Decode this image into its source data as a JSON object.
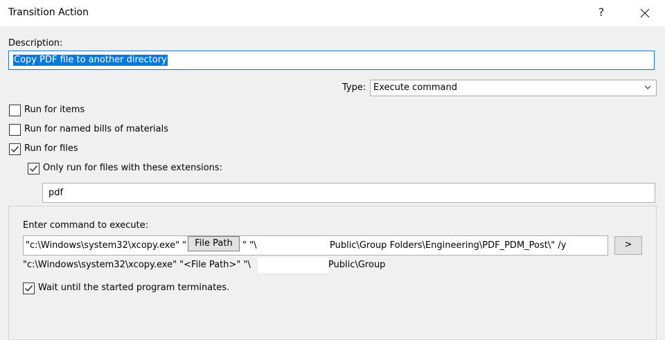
{
  "window": {
    "title": "Transition Action",
    "help_label": "?"
  },
  "description": {
    "label": "Description:",
    "value": "Copy PDF file to another directory"
  },
  "type": {
    "label": "Type:",
    "selected": "Execute command"
  },
  "checkboxes": {
    "run_for_items": {
      "label": "Run for items",
      "checked": false
    },
    "run_for_boms": {
      "label": "Run for named bills of materials",
      "checked": false
    },
    "run_for_files": {
      "label": "Run for files",
      "checked": true
    },
    "only_extensions": {
      "label": "Only run for files with these extensions:",
      "checked": true
    }
  },
  "extensions": {
    "value": "pdf"
  },
  "command": {
    "label": "Enter command to execute:",
    "input_part1": "\"c:\\Windows\\system32\\xcopy.exe\" \"",
    "token": "File Path",
    "input_part2": "\" \"\\",
    "input_part3": "Public\\Group Folders\\Engineering\\PDF_PDM_Post\\\" /y",
    "insert_button": ">",
    "preview_part1": "\"c:\\Windows\\system32\\xcopy.exe\" \"<File Path>\" \"\\",
    "preview_part2": "Public\\Group"
  },
  "wait": {
    "label": "Wait until the started program terminates.",
    "checked": true
  },
  "icons": {
    "close": "close-icon",
    "chevron": "chevron-down-icon",
    "check": "checkmark-icon"
  },
  "colors": {
    "accent": "#0078d7",
    "background": "#f0f0f0",
    "titlebar": "#ffffff"
  }
}
